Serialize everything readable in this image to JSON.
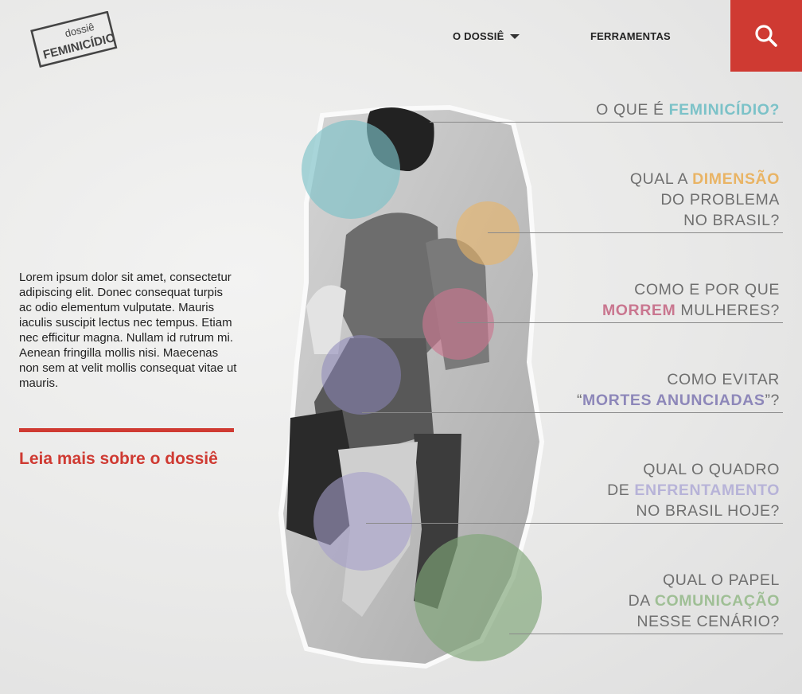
{
  "header": {
    "logo": {
      "top_word": "dossiê",
      "main_word": "FEMINICÍDIO"
    },
    "nav": [
      {
        "label": "O DOSSIÊ",
        "icon": "caret-down-icon"
      },
      {
        "label": "FERRAMENTAS"
      }
    ],
    "search": {
      "icon": "search-icon",
      "background": "#cf3a32"
    }
  },
  "intro": {
    "text": "Lorem ipsum dolor sit amet, consectetur adipiscing elit. Donec consequat turpis ac odio elementum vulputate. Mauris iaculis suscipit lectus nec tempus. Etiam nec efficitur magna. Nullam id rutrum mi. Aenean fringilla mollis nisi. Maecenas non sem at velit mollis consequat vitae ut mauris.",
    "read_more": "Leia mais sobre o dossiê"
  },
  "colors": {
    "accent_red": "#cf3a32",
    "teal": "#7cc2c8",
    "amber": "#e9b465",
    "rose": "#c9768f",
    "violet": "#8d87b9",
    "lavender": "#b7b3d8",
    "sage": "#9fbf95"
  },
  "questions": [
    {
      "pre": "O QUE É ",
      "highlight": "FEMINICÍDIO?",
      "post": "",
      "color": "#7cc2c8"
    },
    {
      "pre": "QUAL A ",
      "highlight": "DIMENSÃO",
      "post": "DO PROBLEMA NO BRASIL?",
      "color": "#e9b465"
    },
    {
      "pre": "COMO E POR QUE",
      "highlight": "MORREM",
      "post": " MULHERES?",
      "color": "#c9768f"
    },
    {
      "pre": "COMO EVITAR",
      "highlight": "MORTES ANUNCIADAS",
      "post": "”?",
      "color": "#8d87b9"
    },
    {
      "pre": "QUAL O QUADRO",
      "highlight": "ENFRENTAMENTO",
      "post": "NO BRASIL HOJE?",
      "color": "#b7b3d8"
    },
    {
      "pre": "QUAL O PAPEL",
      "highlight": "COMUNICAÇÃO",
      "post": "NESSE CENÁRIO?",
      "color": "#9fbf95"
    }
  ]
}
